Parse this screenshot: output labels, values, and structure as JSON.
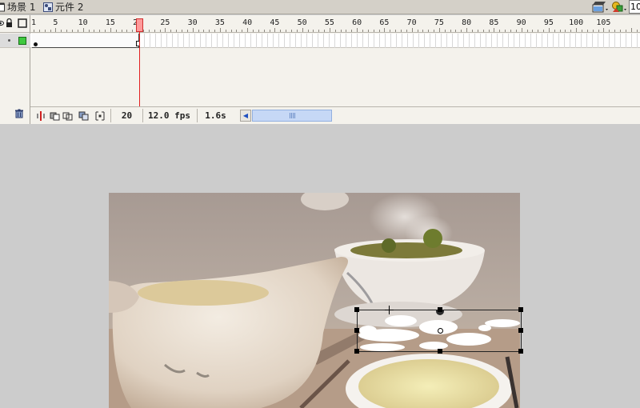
{
  "breadcrumb": {
    "scene_label": "场景 1",
    "symbol_label": "元件 2"
  },
  "toolbar": {
    "zoom_value": "10",
    "edit_scene_icon": "clapperboard-icon",
    "edit_symbol_icon": "shapes-icon"
  },
  "timeline": {
    "ruler_labels": [
      "1",
      "5",
      "10",
      "15",
      "20",
      "25",
      "30",
      "35",
      "40",
      "45",
      "50",
      "55",
      "60",
      "65",
      "70",
      "75",
      "80",
      "85",
      "90",
      "95",
      "100",
      "105"
    ],
    "current_frame": "20",
    "frame_rate": "12.0 fps",
    "elapsed_time": "1.6s",
    "layer_icons": {
      "eye": "eye-icon",
      "lock": "lock-icon",
      "outline": "outline-icon"
    }
  },
  "colors": {
    "playhead": "#e22020",
    "layer_outline": "#3fc93f",
    "stage_background": "#cccccc",
    "panel_background": "#f4f2ec",
    "scroll_thumb": "#c6d8f6"
  }
}
